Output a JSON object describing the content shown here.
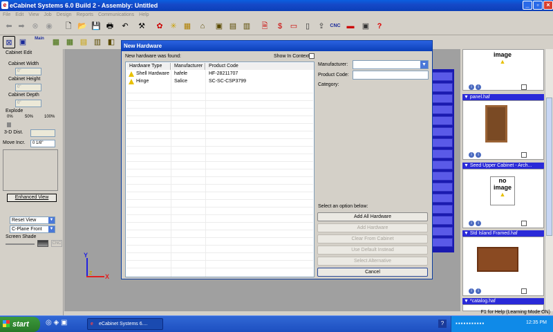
{
  "window": {
    "title": "eCabinet Systems 6.0 Build 2 - Assembly: Untitled",
    "app_icon": "e"
  },
  "menu": [
    "File",
    "Edit",
    "View",
    "Job",
    "Design",
    "Reports",
    "Communications",
    "Help"
  ],
  "toolbar": {
    "cnc_label": "CNC",
    "main_label": "Main",
    "help_glyph": "?"
  },
  "left": {
    "title": "Cabinet Edit",
    "width_label": "Cabinet Width",
    "width_value": "0\"",
    "height_label": "Cabinet Height",
    "height_value": "0\"",
    "depth_label": "Cabinet Depth",
    "depth_value": "0\"",
    "explode_label": "Explode",
    "explode_ticks": [
      "0%",
      "50%",
      "100%"
    ],
    "dist_label": "3-D Dist.",
    "move_label": "Move Incr.",
    "move_value": "0 1/8\"",
    "enhanced_view": "Enhanced View",
    "reset_view": "Reset View",
    "cplane": "C-Plane Front",
    "screen_shade": "Screen Shade",
    "cnc": "CNC"
  },
  "axes": {
    "y": "Y",
    "x": "X",
    "z": "Z"
  },
  "dialog": {
    "title": "New Hardware",
    "found_label": "New hardware was found:",
    "show_context": "Show In Context",
    "columns": [
      "Hardware Type",
      "Manufacturer",
      "Product Code"
    ],
    "rows": [
      {
        "type": "Shell Hardware",
        "manufacturer": "hafele",
        "code": "HF-28211707"
      },
      {
        "type": "Hinge",
        "manufacturer": "Salice",
        "code": "SC-SC-CSP3799"
      }
    ],
    "manufacturer_label": "Manufacturer:",
    "product_code_label": "Product Code:",
    "category_label": "Category:",
    "select_option": "Select an option below:",
    "buttons": {
      "add_all": "Add All Hardware",
      "add": "Add Hardware",
      "clear": "Clear From Cabinet",
      "default": "Use Default Instead",
      "alternative": "Select Alternative",
      "cancel": "Cancel"
    }
  },
  "right": {
    "items": [
      {
        "name": "",
        "image": "image"
      },
      {
        "name": "panel.haf",
        "image": "panel"
      },
      {
        "name": "Seed Upper Cabinet - Arch...",
        "image": "no image"
      },
      {
        "name": "Std Island Framed.haf",
        "image": "cabinet"
      },
      {
        "name": "*catalog.haf",
        "image": ""
      }
    ]
  },
  "status": {
    "help_text": "F1 for Help (Learning Mode ON)"
  },
  "taskbar": {
    "start": "start",
    "task": "eCabinet Systems 6....",
    "clock": "12:35 PM",
    "help": "?"
  },
  "colors": {
    "accent": "#0b3fb8",
    "panel_blue": "#2a2ad8",
    "warning": "#e8c000"
  }
}
